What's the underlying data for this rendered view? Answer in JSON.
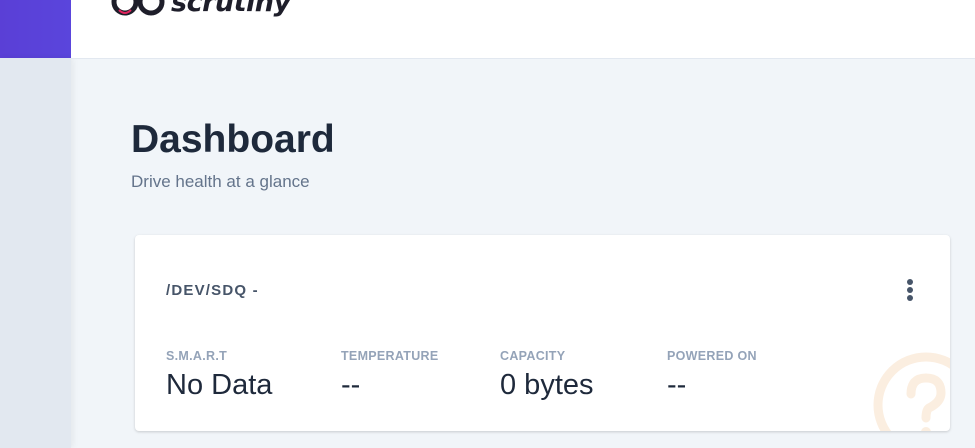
{
  "header": {
    "logo_text": "scrutiny"
  },
  "page": {
    "title": "Dashboard",
    "subtitle": "Drive health at a glance"
  },
  "device_card": {
    "name": "/DEV/SDQ -",
    "stats": [
      {
        "label": "S.M.A.R.T",
        "value": "No Data"
      },
      {
        "label": "TEMPERATURE",
        "value": "--"
      },
      {
        "label": "CAPACITY",
        "value": "0 bytes"
      },
      {
        "label": "POWERED ON",
        "value": "--"
      }
    ],
    "watermark_icon": "help-circle-icon",
    "menu_icon": "more-vertical-icon"
  },
  "colors": {
    "brand": "#5a45dc",
    "background": "#f1f5f9",
    "watermark": "#fbeee0"
  }
}
